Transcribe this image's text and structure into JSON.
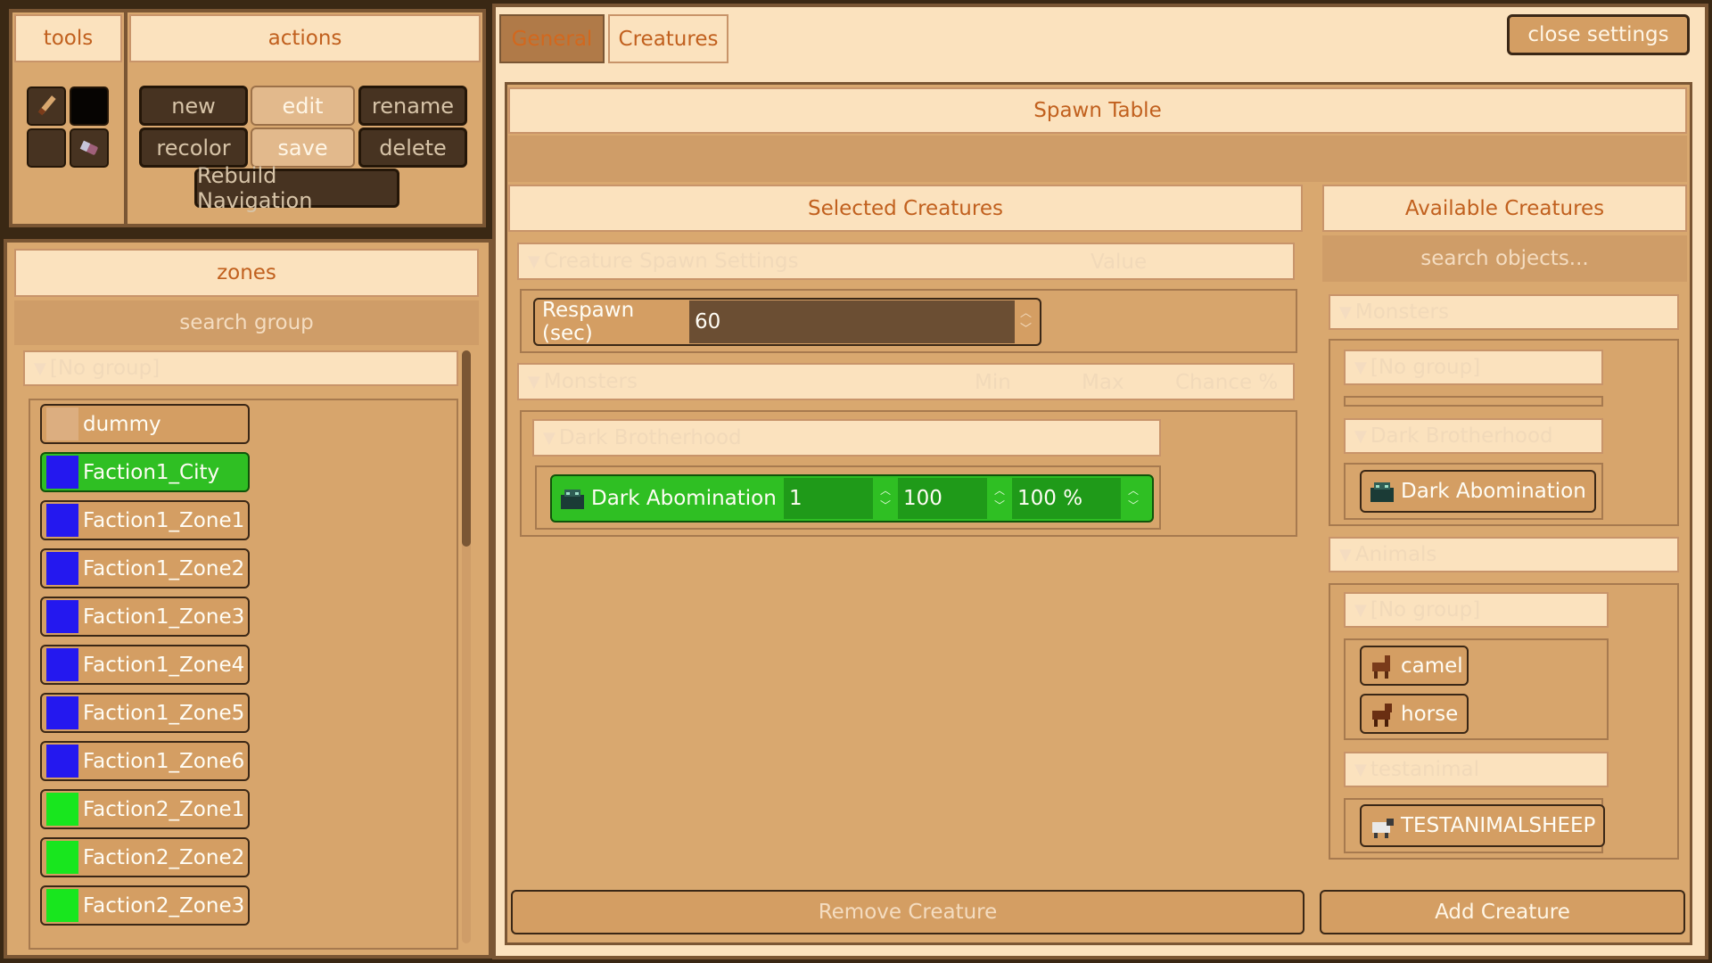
{
  "tools": {
    "header": "tools"
  },
  "actions": {
    "header": "actions",
    "new": "new",
    "edit": "edit",
    "rename": "rename",
    "recolor": "recolor",
    "save": "save",
    "delete": "delete",
    "rebuild": "Rebuild Navigation"
  },
  "zones": {
    "header": "zones",
    "search_placeholder": "search group",
    "group_label": "[No group]",
    "items": [
      {
        "label": "dummy",
        "color": "#dcae80"
      },
      {
        "label": "Faction1_City",
        "color": "#2418ef",
        "selected": true
      },
      {
        "label": "Faction1_Zone1",
        "color": "#2418ef"
      },
      {
        "label": "Faction1_Zone2",
        "color": "#2418ef"
      },
      {
        "label": "Faction1_Zone3",
        "color": "#2418ef"
      },
      {
        "label": "Faction1_Zone4",
        "color": "#2418ef"
      },
      {
        "label": "Faction1_Zone5",
        "color": "#2418ef"
      },
      {
        "label": "Faction1_Zone6",
        "color": "#2418ef"
      },
      {
        "label": "Faction2_Zone1",
        "color": "#18e61e"
      },
      {
        "label": "Faction2_Zone2",
        "color": "#18e61e"
      },
      {
        "label": "Faction2_Zone3",
        "color": "#18e61e"
      }
    ]
  },
  "tabs": {
    "general": "General",
    "creatures": "Creatures"
  },
  "close_settings": "close settings",
  "spawn_table": {
    "header": "Spawn Table"
  },
  "selected": {
    "header": "Selected Creatures",
    "settings_group": "Creature Spawn Settings",
    "value_col": "Value",
    "respawn_label": "Respawn (sec)",
    "respawn_value": "60",
    "monsters_group": "Monsters",
    "min_col": "Min",
    "max_col": "Max",
    "chance_col": "Chance %",
    "subgroup": "Dark Brotherhood",
    "creature_name": "Dark Abomination",
    "min_value": "1",
    "max_value": "100",
    "chance_value": "100 %",
    "remove": "Remove Creature"
  },
  "available": {
    "header": "Available Creatures",
    "search_placeholder": "search objects...",
    "monsters": "Monsters",
    "no_group": "[No group]",
    "dark_brotherhood": "Dark Brotherhood",
    "dark_abomination": "Dark Abomination",
    "animals": "Animals",
    "animals_no_group": "[No group]",
    "camel": "camel",
    "horse": "horse",
    "testanimal": "testanimal",
    "testanimalsheep": "TESTANIMALSHEEP",
    "add": "Add Creature"
  },
  "colors": {
    "accent_text": "#c1601e",
    "panel": "#d9a86f",
    "selected_green": "#2fbf23"
  }
}
